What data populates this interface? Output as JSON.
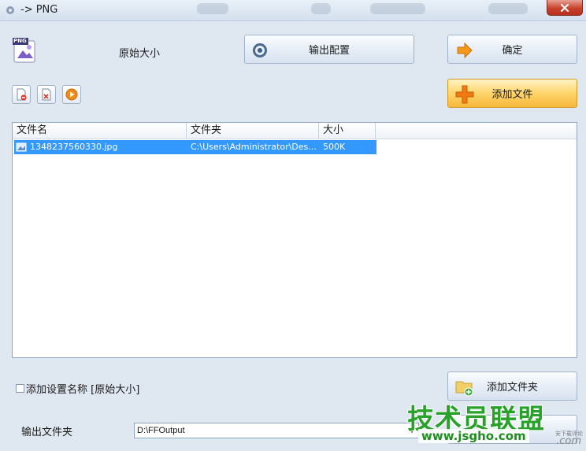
{
  "window": {
    "title": "-> PNG"
  },
  "header": {
    "format_badge": "PNG",
    "size_label": "原始大小",
    "output_config_label": "输出配置",
    "ok_label": "确定",
    "add_file_label": "添加文件"
  },
  "file_list": {
    "columns": [
      "文件名",
      "文件夹",
      "大小"
    ],
    "rows": [
      {
        "name": "1348237560330.jpg",
        "folder": "C:\\Users\\Administrator\\Des...",
        "size": "500K"
      }
    ]
  },
  "footer": {
    "checkbox_label": "添加设置名称 [原始大小]",
    "add_folder_label": "添加文件夹",
    "output_folder_label": "输出文件夹",
    "output_folder_value": "D:\\FFOutput"
  },
  "watermark": {
    "main": "技术员联盟",
    "url": "www.jsgho.com",
    "tag": "安下载评论",
    "com": ".com"
  },
  "colors": {
    "selection": "#3399ff",
    "accent_orange": "#f5b73a"
  }
}
